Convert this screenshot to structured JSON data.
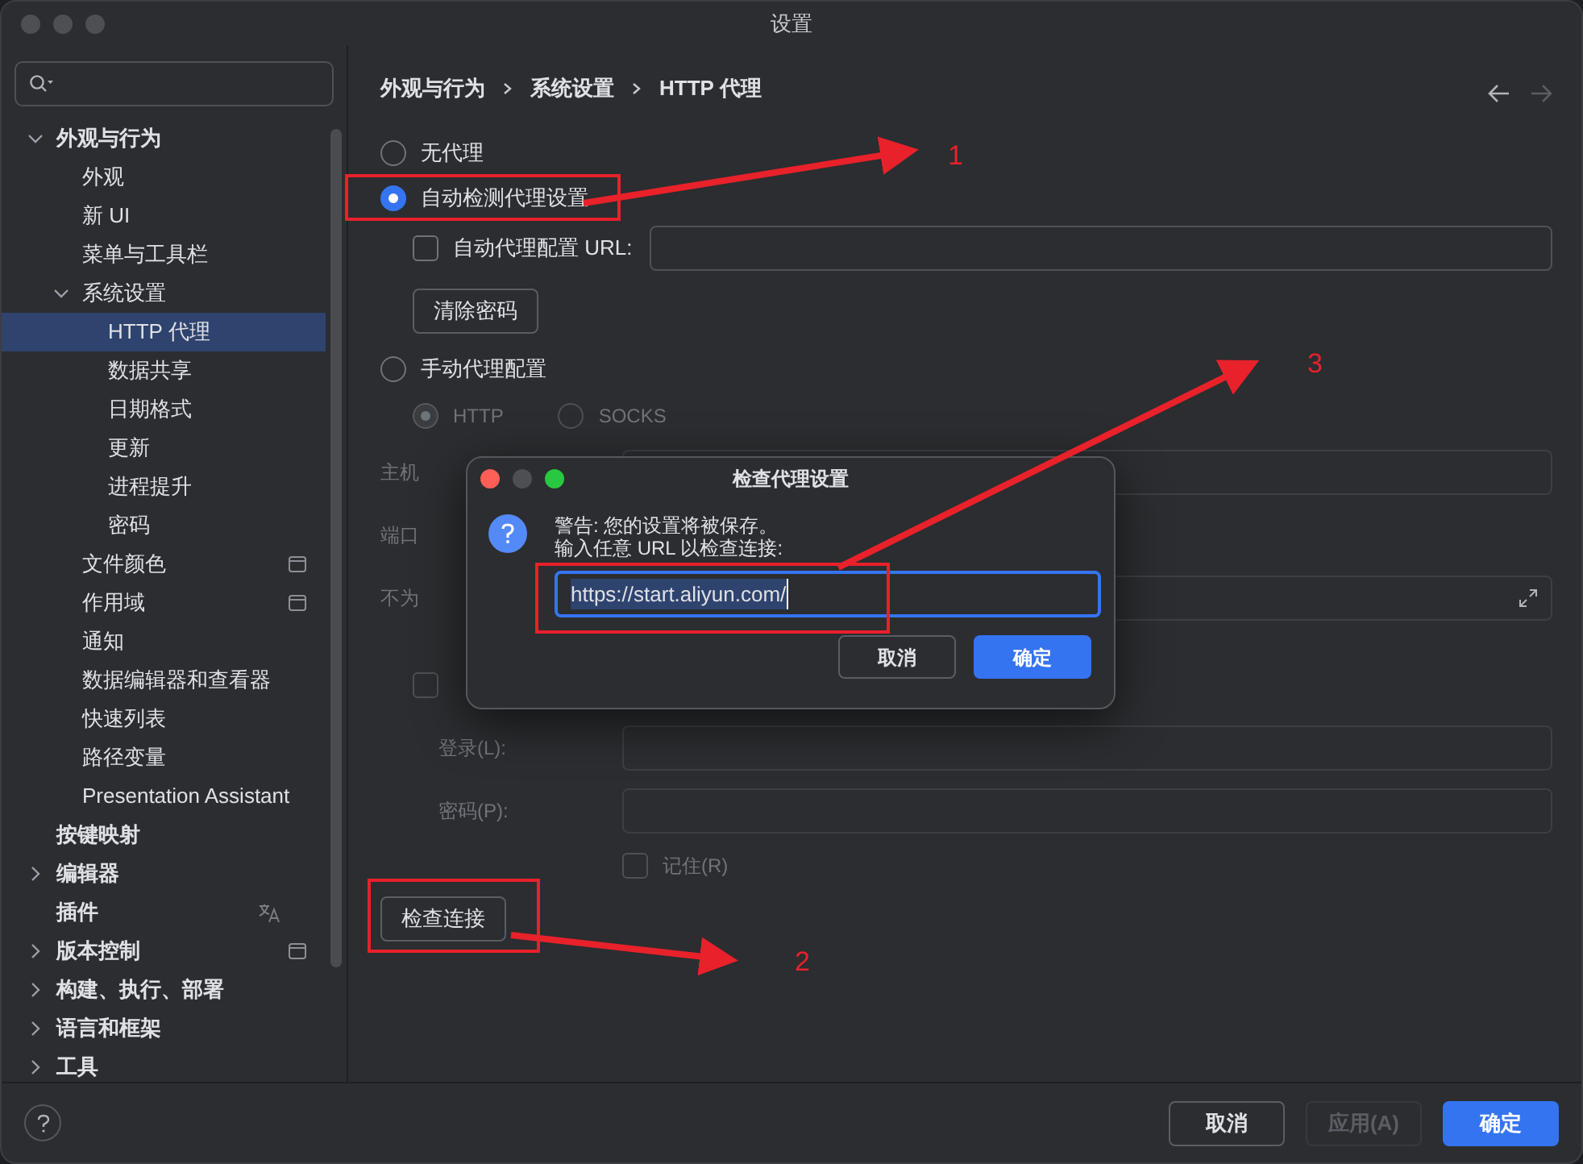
{
  "window": {
    "title": "设置"
  },
  "sidebar": {
    "items": [
      {
        "label": "外观与行为",
        "expanded": true,
        "selected": false,
        "children": [
          {
            "label": "外观",
            "selected": false
          },
          {
            "label": "新 UI",
            "selected": false
          },
          {
            "label": "菜单与工具栏",
            "selected": false
          },
          {
            "label": "系统设置",
            "expanded": true,
            "selected": false,
            "children": [
              {
                "label": "HTTP 代理",
                "selected": true
              },
              {
                "label": "数据共享",
                "selected": false
              },
              {
                "label": "日期格式",
                "selected": false
              },
              {
                "label": "更新",
                "selected": false
              },
              {
                "label": "进程提升",
                "selected": false
              },
              {
                "label": "密码",
                "selected": false
              }
            ]
          },
          {
            "label": "文件颜色",
            "selected": false,
            "window_scoped": true
          },
          {
            "label": "作用域",
            "selected": false,
            "window_scoped": true
          },
          {
            "label": "通知",
            "selected": false
          },
          {
            "label": "数据编辑器和查看器",
            "selected": false
          },
          {
            "label": "快速列表",
            "selected": false
          },
          {
            "label": "路径变量",
            "selected": false
          },
          {
            "label": "Presentation Assistant",
            "selected": false
          }
        ]
      },
      {
        "label": "按键映射",
        "selected": false
      },
      {
        "label": "编辑器",
        "expanded": false,
        "selected": false
      },
      {
        "label": "插件",
        "selected": false,
        "translatable": true
      },
      {
        "label": "版本控制",
        "expanded": false,
        "selected": false,
        "window_scoped": true
      },
      {
        "label": "构建、执行、部署",
        "expanded": false,
        "selected": false
      },
      {
        "label": "语言和框架",
        "expanded": false,
        "selected": false
      },
      {
        "label": "工具",
        "expanded": false,
        "selected": false
      }
    ]
  },
  "breadcrumb": [
    "外观与行为",
    "系统设置",
    "HTTP 代理"
  ],
  "proxy_modes": [
    {
      "label": "无代理",
      "selected": false
    },
    {
      "label": "自动检测代理设置",
      "selected": true
    },
    {
      "label": "手动代理配置",
      "selected": false
    }
  ],
  "auto": {
    "pac_checkbox": {
      "label": "自动代理配置 URL:",
      "checked": false
    },
    "clear_button": "清除密码"
  },
  "manual": {
    "disabled": true,
    "protocols": [
      {
        "label": "HTTP",
        "selected": true
      },
      {
        "label": "SOCKS",
        "selected": false
      }
    ],
    "host_label": "主机",
    "port_label": "端口",
    "no_proxy_label": "不为",
    "auth_checkbox": {
      "checked": false
    },
    "login_label": "登录(L):",
    "password_label": "密码(P):",
    "remember": {
      "label": "记住(R)",
      "checked": false
    }
  },
  "check_button": "检查连接",
  "dialog": {
    "title": "检查代理设置",
    "message": [
      "警告: 您的设置将被保存。",
      "输入任意 URL 以检查连接:"
    ],
    "value": "https://start.aliyun.com/",
    "buttons": [
      {
        "label": "取消",
        "primary": false
      },
      {
        "label": "确定",
        "primary": true
      }
    ]
  },
  "footer": {
    "buttons": [
      {
        "label": "取消",
        "primary": false,
        "disabled": false
      },
      {
        "label": "应用(A)",
        "primary": false,
        "disabled": true
      },
      {
        "label": "确定",
        "primary": true,
        "disabled": false
      }
    ]
  },
  "annotations": [
    "1",
    "2",
    "3"
  ]
}
